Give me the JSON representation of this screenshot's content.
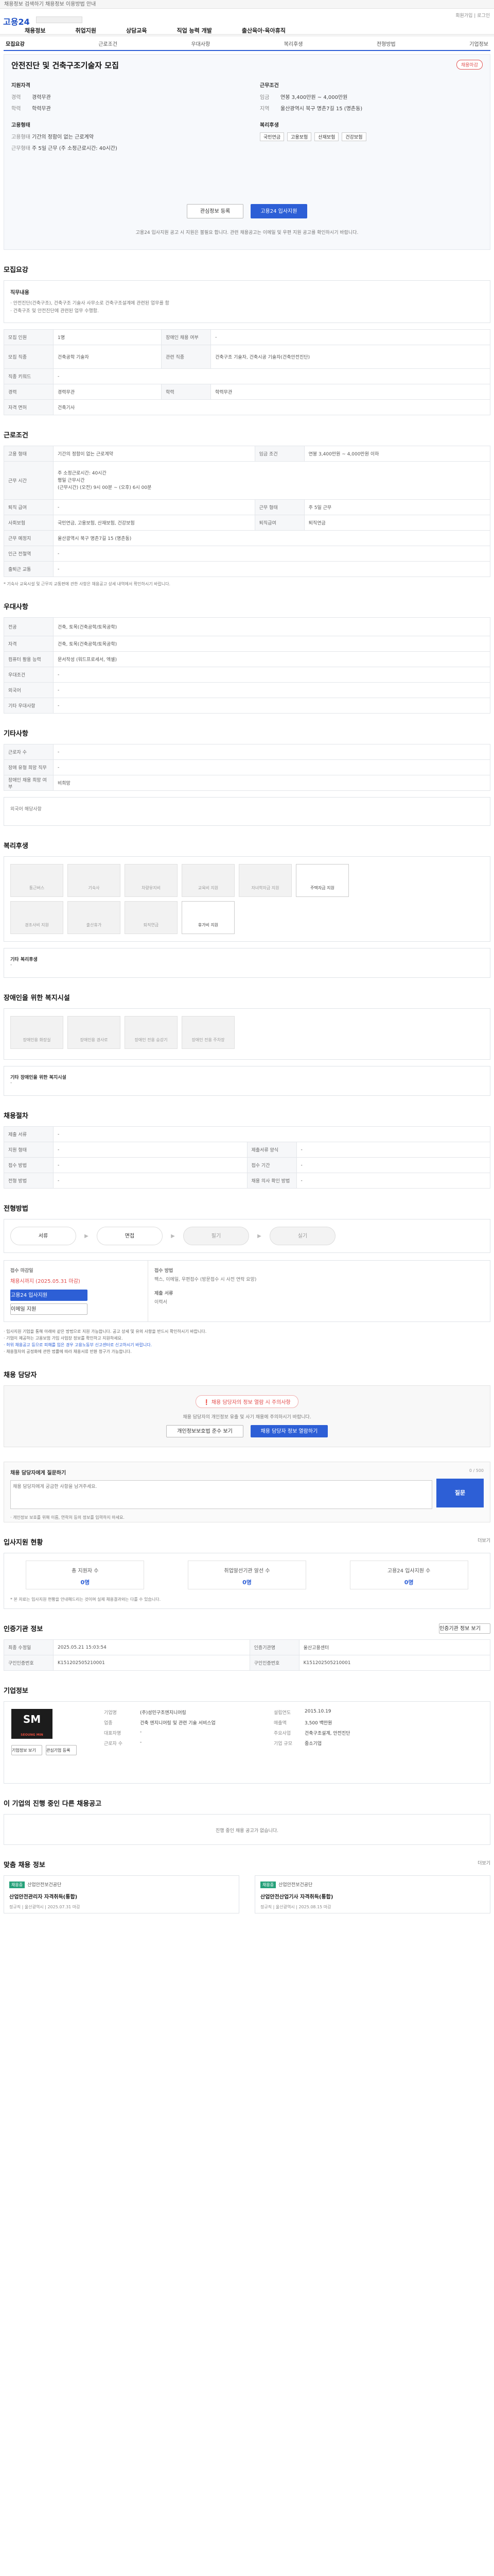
{
  "topbar": {
    "text": "채용정보 검색하기 채용정보 이용방법 안내"
  },
  "header": {
    "logo": "고용24",
    "top_right": "회원가입 | 로그인",
    "gnb": [
      "채용정보",
      "취업지원",
      "상담교육",
      "직업 능력 개발",
      "출산육아·육아휴직"
    ]
  },
  "tabs": [
    "모집요강",
    "근로조건",
    "우대사항",
    "복리후생",
    "전형방법",
    "기업정보"
  ],
  "job": {
    "title": "안전진단 및 건축구조기술자 모집",
    "badge": "채용마감",
    "recruit_title": "지원자격",
    "career_k": "경력",
    "career_v": "경력무관",
    "edu_k": "학력",
    "edu_v": "학력무관",
    "work_title": "근무조건",
    "pay_k": "임금",
    "pay_v": "연봉 3,400만원 ~ 4,000만원",
    "region_k": "지역",
    "region_v": "울산광역시 북구 명촌7길 15 (명촌동)",
    "type_title": "고용형태",
    "type_k": "고용형태",
    "type_v": "기간의 정함이 없는 근로계약",
    "hours_k": "근무형태",
    "hours_v": "주 5일 근무 (주 소정근로시간: 40시간)",
    "welfare_title": "복리후생",
    "chips": [
      "국민연금",
      "고용보험",
      "산재보험",
      "건강보험"
    ],
    "btn_interest": "관심정보 등록",
    "btn_apply": "고용24 입사지원",
    "notice": "고용24 입사지원 공고 시 지원은 불필요 합니다. 관련 채용공고는 이메일 및 우편 지원 공고를 확인하시기 바랍니다."
  },
  "recruit": {
    "title": "모집요강",
    "job_title": "직무내용",
    "desc": "· 안전진단(건축구조), 건축구조 기술사 사무소로 건축구조설계에 관련된 업무를 함\n· 건축구조 및 안전진단에 관련된 업무 수행함.",
    "rows": [
      [
        "모집 인원",
        "1명",
        "장애인 채용 여부",
        "-"
      ],
      [
        "모집 직종",
        "건축공학 기술자",
        "관련 직종",
        "건축구조 기술자, 건축시공 기술자(건축안전진단)"
      ],
      [
        "직종 키워드",
        "-",
        "",
        ""
      ],
      [
        "경력",
        "경력무관",
        "학력",
        "학력무관"
      ],
      [
        "자격 면허",
        "건축기사",
        "",
        ""
      ]
    ]
  },
  "conditions": {
    "title": "근로조건",
    "rows": [
      [
        "고용 형태",
        "기간의 정함이 없는 근로계약",
        "임금 조건",
        "연봉 3,400만원 ~ 4,000만원 이하"
      ],
      [
        "근무 시간",
        "주 소정근로시간: 40시간\n평일 근무시간\n(근무시간) (오전) 9시 00분 ~ (오후) 6시 00분",
        ""
      ],
      [
        "퇴직 급여",
        "-",
        "근무 형태",
        "주 5일 근무"
      ],
      [
        "사회보험",
        "국민연금, 고용보험, 산재보험, 건강보험",
        "퇴직급여",
        "퇴직연금"
      ],
      [
        "근무 예정지",
        "울산광역시 북구 명촌7길 15 (명촌동)",
        "",
        ""
      ],
      [
        "인근 전철역",
        "-",
        "",
        ""
      ],
      [
        "출퇴근 교통",
        "-",
        "",
        ""
      ]
    ],
    "note": "* 기숙사 교육시설 및 근무지 교통편에 관한 사항은 채용공고 상세 내역에서 확인하시기 바랍니다."
  },
  "preference": {
    "title": "우대사항",
    "rows": [
      [
        "전공",
        "건축, 토목(건축공학/토목공학)"
      ],
      [
        "자격",
        "건축, 토목(건축공학/토목공학)"
      ],
      [
        "컴퓨터 활용 능력",
        "문서작성 (워드프로세서, 엑셀)"
      ],
      [
        "우대조건",
        "-"
      ],
      [
        "외국어",
        "-"
      ],
      [
        "기타 우대사항",
        "-"
      ]
    ]
  },
  "disability": {
    "title": "기타사항",
    "rows": [
      [
        "근로자 수",
        "-"
      ],
      [
        "장애 유형 희망 직무",
        "-"
      ],
      [
        "장애인 채용 희망 여부",
        "비희망"
      ]
    ],
    "foreign": "외국어 해당사항"
  },
  "welfare": {
    "title": "복리후생",
    "tiles": [
      "통근버스",
      "기숙사",
      "차량유지비",
      "교육비 지원",
      "자녀학자금 지원",
      "주택자금 지원",
      "경조사비 지원",
      "출산휴가",
      "퇴직연금",
      "휴가비 지원"
    ],
    "etc_title": "기타 복리후생",
    "etc": "-"
  },
  "disabled_env": {
    "title": "장애인을 위한 복지시설",
    "tiles": [
      "장애인용 화장실",
      "장애인용 경사로",
      "장애인 전용 승강기",
      "장애인 전용 주차장"
    ],
    "etc_title": "기타 장애인을 위한 복지시설",
    "etc": "-"
  },
  "apply_method": {
    "title": "채용절차",
    "rows": [
      [
        "제출 서류",
        "-",
        "",
        ""
      ],
      [
        "지원 형태",
        "-",
        "제출서류 양식",
        "-"
      ],
      [
        "접수 방법",
        "-",
        "접수 기간",
        "-"
      ],
      [
        "전형 방법",
        "-",
        "채용 의사 확인 방법",
        "-"
      ]
    ]
  },
  "process": {
    "title": "전형방법",
    "steps": [
      "서류",
      "면접",
      "필기",
      "실기"
    ]
  },
  "apply_info": {
    "k1": "접수 마감일",
    "v1": "채용시까지 (2025.05.31 마감)",
    "btn_apply": "고용24 입사지원",
    "btn_email": "이메일 지원",
    "k2": "접수 방법",
    "v2": "팩스, 이메일, 우편접수 (방문접수 시 사전 연락 요망)",
    "k3": "제출 서류",
    "v3": "이력서"
  },
  "notices": [
    "· 입사지원 기업을 통해 아래와 같은 방법으로 지원 가능합니다. 공고 상세 및 유의 사항을 반드시 확인하시기 바랍니다.",
    "· 기업이 제공하는 고용보험 가입 사업장 정보를 확인하고 지원하세요.",
    "· 허위 채용공고 등으로 피해를 입은 경우 고용노동부 신고센터로 신고하시기 바랍니다.",
    "· 채용절차의 공정화에 관한 법률에 따라 채용서류 반환 청구가 가능합니다."
  ],
  "contact": {
    "title": "채용 담당자",
    "pill": "채용 담당자의 정보 열람 시 주의사항",
    "text": "채용 담당자의 개인정보 유출 및 사기 채용에 주의하시기 바랍니다.",
    "btn1": "개인정보보호법 준수 보기",
    "btn2": "채용 담당자 정보 열람하기"
  },
  "question": {
    "title": "채용 담당자에게 질문하기",
    "count": "0 / 500",
    "placeholder": "채용 담당자에게 궁금한 사항을 남겨주세요.",
    "btn": "질문",
    "note": "· 개인정보 보호를 위해 이름, 연락처 등의 정보를 입력하지 마세요."
  },
  "status": {
    "title": "입사지원 현황",
    "more": "더보기",
    "items": [
      [
        "총 지원자 수",
        "0명"
      ],
      [
        "취업알선기관 알선 수",
        "0명"
      ],
      [
        "고용24 입사지원 수",
        "0명"
      ]
    ],
    "note": "* 본 자료는 입사지원 현황을 안내해드리는 것이며 실제 채용결과와는 다를 수 있습니다."
  },
  "admin": {
    "title": "인증기관 정보",
    "btn": "인증기관 정보 보기",
    "rows": [
      [
        "최종 수정일",
        "2025.05.21 15:03:54",
        "인증기관명",
        "울산고용센터"
      ],
      [
        "구인인증번호",
        "K151202505210001",
        "구인인증번호",
        "K151202505210001"
      ]
    ]
  },
  "company": {
    "title": "기업정보",
    "logo": "SM",
    "logo_sub": "SEOUNG MIN",
    "rows": [
      [
        "기업명",
        "(주)성민구조엔지니어링",
        "설립연도",
        "2015.10.19"
      ],
      [
        "업종",
        "건축 엔지니어링 및 관련 기술 서비스업",
        "매출액",
        "3,500 백만원"
      ],
      [
        "대표자명",
        "-",
        "주요사업",
        "건축구조설계, 안전진단"
      ],
      [
        "근로자 수",
        "-",
        "기업 규모",
        "중소기업"
      ]
    ],
    "btn1": "기업정보 보기",
    "btn2": "관심기업 등록"
  },
  "other_jobs": {
    "title": "이 기업의 진행 중인 다른 채용공고",
    "empty": "진행 중인 채용 공고가 없습니다."
  },
  "recommend": {
    "title": "맞춤 채용 정보",
    "more": "더보기",
    "cards": [
      {
        "tag": "채용중",
        "org": "산업안전보건공단",
        "title": "산업안전관리자 자격취득(통합)",
        "meta": "정규직 | 울산광역시 | 2025.07.31 마감"
      },
      {
        "tag": "채용중",
        "org": "산업안전보건공단",
        "title": "산업안전산업기사 자격취득(통합)",
        "meta": "정규직 | 울산광역시 | 2025.08.15 마감"
      }
    ]
  }
}
